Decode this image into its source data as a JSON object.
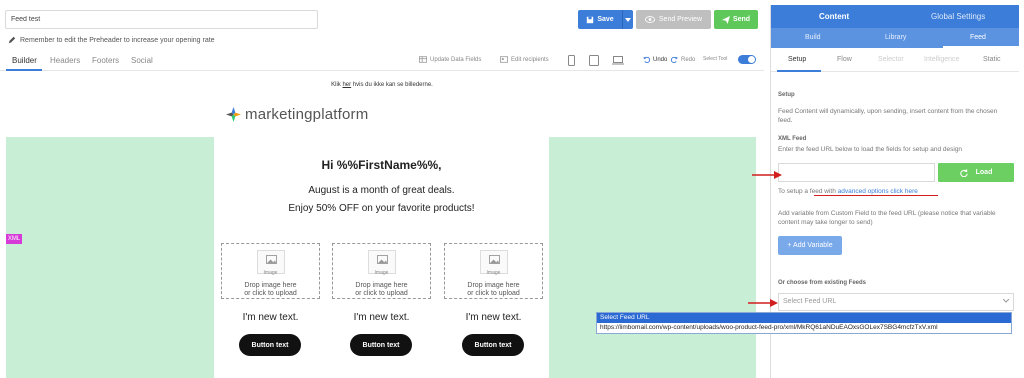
{
  "editor": {
    "subject_value": "Feed test",
    "preheader_note": "Remember to edit the Preheader to increase your opening rate",
    "save_label": "Save",
    "preview_label": "Send Preview",
    "send_label": "Send",
    "tabs": [
      "Builder",
      "Headers",
      "Footers",
      "Social"
    ],
    "tools": {
      "update_fields": "Update Data Fields",
      "edit_recipients": "Edit recipients",
      "undo": "Undo",
      "redo": "Redo",
      "select_tool": "Select Tool"
    }
  },
  "email": {
    "view_link_prefix": "Klik ",
    "view_link_word": "her",
    "view_link_suffix": " hvis du ikke kan se billederne.",
    "logo_text": "marketingplatform",
    "greeting": "Hi %%FirstName%%,",
    "offer_line1": "August is a month of great deals.",
    "offer_line2": "Enjoy 50% OFF on your favorite products!",
    "image_label": "Image",
    "drop_line1": "Drop image here",
    "drop_line2": "or click to upload",
    "new_text": "I'm new text.",
    "button_text": "Button text",
    "xml_tag": "XML"
  },
  "panel": {
    "top_tabs": [
      "Content",
      "Global Settings"
    ],
    "sub_tabs": [
      "Build",
      "Library",
      "Feed"
    ],
    "feed_tabs": [
      "Setup",
      "Flow",
      "Selector",
      "Intelligence",
      "Static"
    ],
    "setup_heading": "Setup",
    "setup_text": "Feed Content will dynamically, upon sending, insert content from the chosen feed.",
    "xml_heading": "XML Feed",
    "xml_text": "Enter the feed URL below to load the fields for setup and design",
    "load_label": "Load",
    "adv_prefix": "To setup a feed with ",
    "adv_link1": "advanced options",
    "adv_link2": "click here",
    "custom_field_text": "Add variable from Custom Field to the feed URL (please notice that variable content may take longer to send)",
    "add_variable_label": "+ Add Variable",
    "existing_heading": "Or choose from existing Feeds",
    "select_placeholder": "Select Feed URL"
  },
  "dropdown": {
    "options": [
      "Select Feed URL",
      "https://limbomail.com/wp-content/uploads/woo-product-feed-pro/xml/MkRQ61aNDuEAOxsGOLex7SBG4mcfzTxV.xml"
    ]
  },
  "colors": {
    "primary": "#3b7dd8",
    "success": "#5fc85b",
    "band": "#c9eed6",
    "annotation_red": "#d21e1e"
  }
}
